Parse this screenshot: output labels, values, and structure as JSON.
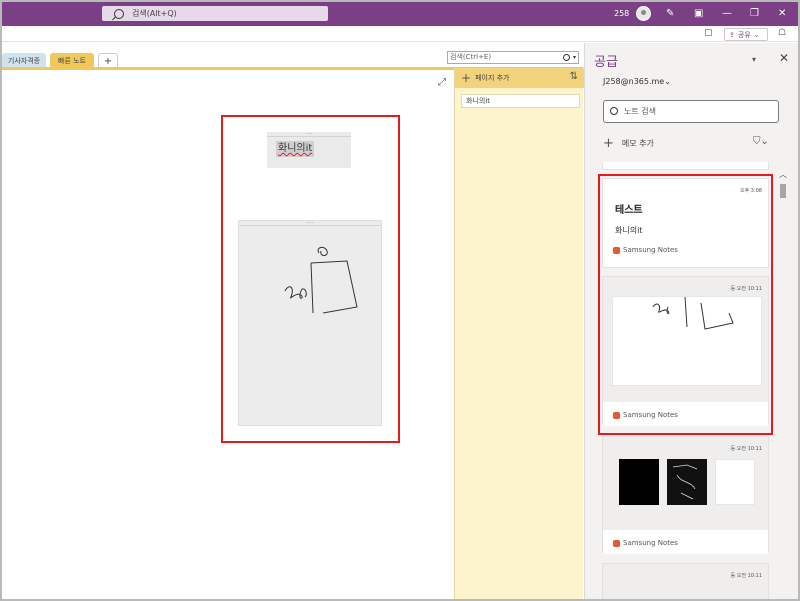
{
  "titlebar": {
    "search_label": "검색(Alt+Q)",
    "user_number": "258"
  },
  "ribbon": {
    "share_label": "공유"
  },
  "sections": {
    "tabs": [
      {
        "label": "기사자격증"
      },
      {
        "label": "빠른 노트"
      },
      {
        "label": "+"
      }
    ],
    "page_search_placeholder": "검색(Ctrl+E)"
  },
  "canvas": {
    "small_card_text": "화니의it"
  },
  "pages": {
    "add_page_label": "페이지 추가",
    "items": [
      {
        "title": "화니의it"
      }
    ]
  },
  "feed": {
    "title": "공급",
    "account": "J258@n365.me",
    "search_placeholder": "노트 검색",
    "add_memo_label": "메모 추가",
    "cards": [
      {
        "time": "오후 3:08",
        "title": "테스트",
        "body": "화니의it",
        "source": "Samsung Notes"
      },
      {
        "time": "등 오전 10:11",
        "source": "Samsung Notes"
      },
      {
        "time": "등 오전 10:11",
        "source": "Samsung Notes"
      },
      {
        "time": "등 오전 10:11"
      }
    ]
  },
  "colors": {
    "title_bar": "#7a3f85",
    "section_accent": "#f0c95a",
    "page_panel": "#fdf3cc",
    "highlight_border": "#e31b1b"
  }
}
